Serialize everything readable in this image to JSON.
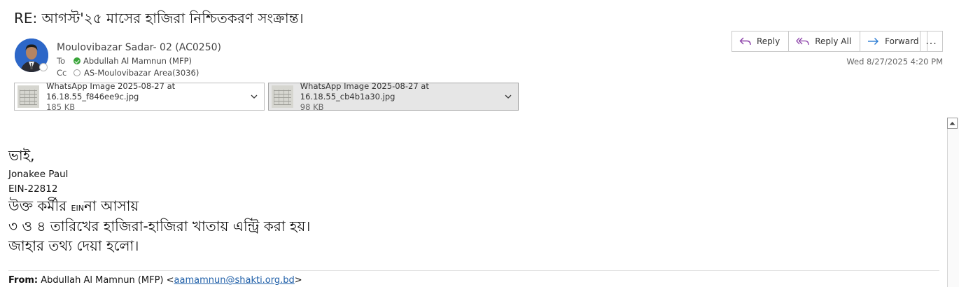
{
  "subject": "RE: আগস্ট'২৫  মাসের হাজিরা নিশ্চিতকরণ সংক্রান্ত।",
  "sender": "Moulovibazar Sadar- 02 (AC0250)",
  "to": {
    "label": "To",
    "name": "Abdullah Al Mamnun (MFP)"
  },
  "cc": {
    "label": "Cc",
    "name": "AS-Moulovibazar Area(3036)"
  },
  "actions": {
    "reply": "Reply",
    "reply_all": "Reply All",
    "forward": "Forward",
    "more": "..."
  },
  "date": "Wed 8/27/2025 4:20 PM",
  "attachments": [
    {
      "name": "WhatsApp Image 2025-08-27 at 16.18.55_f846ee9c.jpg",
      "size": "185 KB"
    },
    {
      "name": "WhatsApp Image 2025-08-27 at 16.18.55_cb4b1a30.jpg",
      "size": "98 KB"
    }
  ],
  "body": {
    "greeting": "ভাই,",
    "name": "Jonakee Paul",
    "ein": "EIN-22812",
    "line1a": "উক্ত কর্মীর",
    "line1_ein": "EIN",
    "line1b": "না আসায়",
    "line2": "৩ ও ৪ তারিখের হাজিরা-হাজিরা খাতায় এন্ট্রি করা হয়।",
    "line3": "জাহার তথ্য দেয়া হলো।"
  },
  "quoted": {
    "from_label": "From:",
    "from_name": "Abdullah Al Mamnun (MFP) <",
    "from_email": "aamamnun@shakti.org.bd",
    "from_close": ">"
  }
}
